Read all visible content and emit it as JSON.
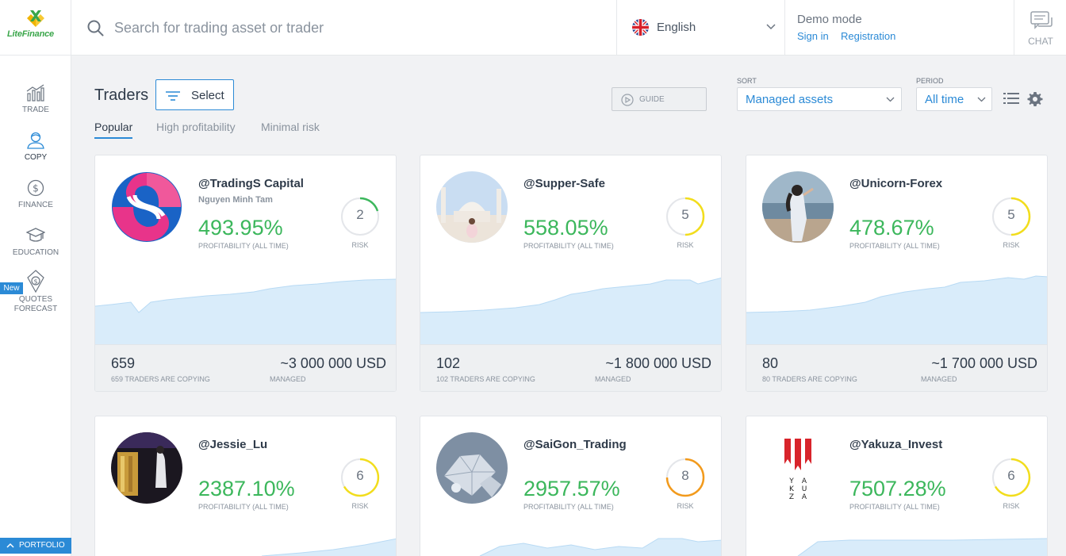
{
  "header": {
    "logo": "LiteFinance",
    "search_placeholder": "Search for trading asset or trader",
    "language": "English",
    "demo_mode": "Demo mode",
    "sign_in": "Sign in",
    "registration": "Registration",
    "chat": "CHAT"
  },
  "sidebar": {
    "items": [
      {
        "label": "TRADE",
        "icon": "chart-icon"
      },
      {
        "label": "COPY",
        "icon": "person-icon"
      },
      {
        "label": "FINANCE",
        "icon": "dollar-icon"
      },
      {
        "label": "EDUCATION",
        "icon": "graduation-cap-icon"
      },
      {
        "label": "QUOTES FORECAST",
        "icon": "forecast-icon"
      }
    ],
    "new_badge": "New",
    "portfolio": "PORTFOLIO"
  },
  "toolbar": {
    "title": "Traders",
    "select": "Select",
    "guide": "GUIDE",
    "sort_label": "SORT",
    "sort_value": "Managed assets",
    "period_label": "PERIOD",
    "period_value": "All time",
    "tabs": [
      "Popular",
      "High profitability",
      "Minimal risk"
    ]
  },
  "colors": {
    "accent": "#2b8ad6",
    "profit": "#3cb75c",
    "risk_low": "#3cb75c",
    "risk_mid": "#f2dd1c",
    "risk_high": "#f29a1c"
  },
  "cards": [
    {
      "name": "@TradingS Capital",
      "sub": "Nguyen Minh Tam",
      "profit": "493.95%",
      "profit_label": "PROFITABILITY (ALL TIME)",
      "risk": "2",
      "risk_label": "RISK",
      "copiers": "659",
      "copiers_label": "659 TRADERS ARE COPYING",
      "managed": "~3 000 000 USD",
      "managed_label": "MANAGED"
    },
    {
      "name": "@Supper-Safe",
      "sub": "",
      "profit": "558.05%",
      "profit_label": "PROFITABILITY (ALL TIME)",
      "risk": "5",
      "risk_label": "RISK",
      "copiers": "102",
      "copiers_label": "102 TRADERS ARE COPYING",
      "managed": "~1 800 000 USD",
      "managed_label": "MANAGED"
    },
    {
      "name": "@Unicorn-Forex",
      "sub": "",
      "profit": "478.67%",
      "profit_label": "PROFITABILITY (ALL TIME)",
      "risk": "5",
      "risk_label": "RISK",
      "copiers": "80",
      "copiers_label": "80 TRADERS ARE COPYING",
      "managed": "~1 700 000 USD",
      "managed_label": "MANAGED"
    },
    {
      "name": "@Jessie_Lu",
      "sub": "",
      "profit": "2387.10%",
      "profit_label": "PROFITABILITY (ALL TIME)",
      "risk": "6",
      "risk_label": "RISK"
    },
    {
      "name": "@SaiGon_Trading",
      "sub": "",
      "profit": "2957.57%",
      "profit_label": "PROFITABILITY (ALL TIME)",
      "risk": "8",
      "risk_label": "RISK"
    },
    {
      "name": "@Yakuza_Invest",
      "sub": "",
      "profit": "7507.28%",
      "profit_label": "PROFITABILITY (ALL TIME)",
      "risk": "6",
      "risk_label": "RISK",
      "logo_text": "YAKUZA"
    }
  ]
}
